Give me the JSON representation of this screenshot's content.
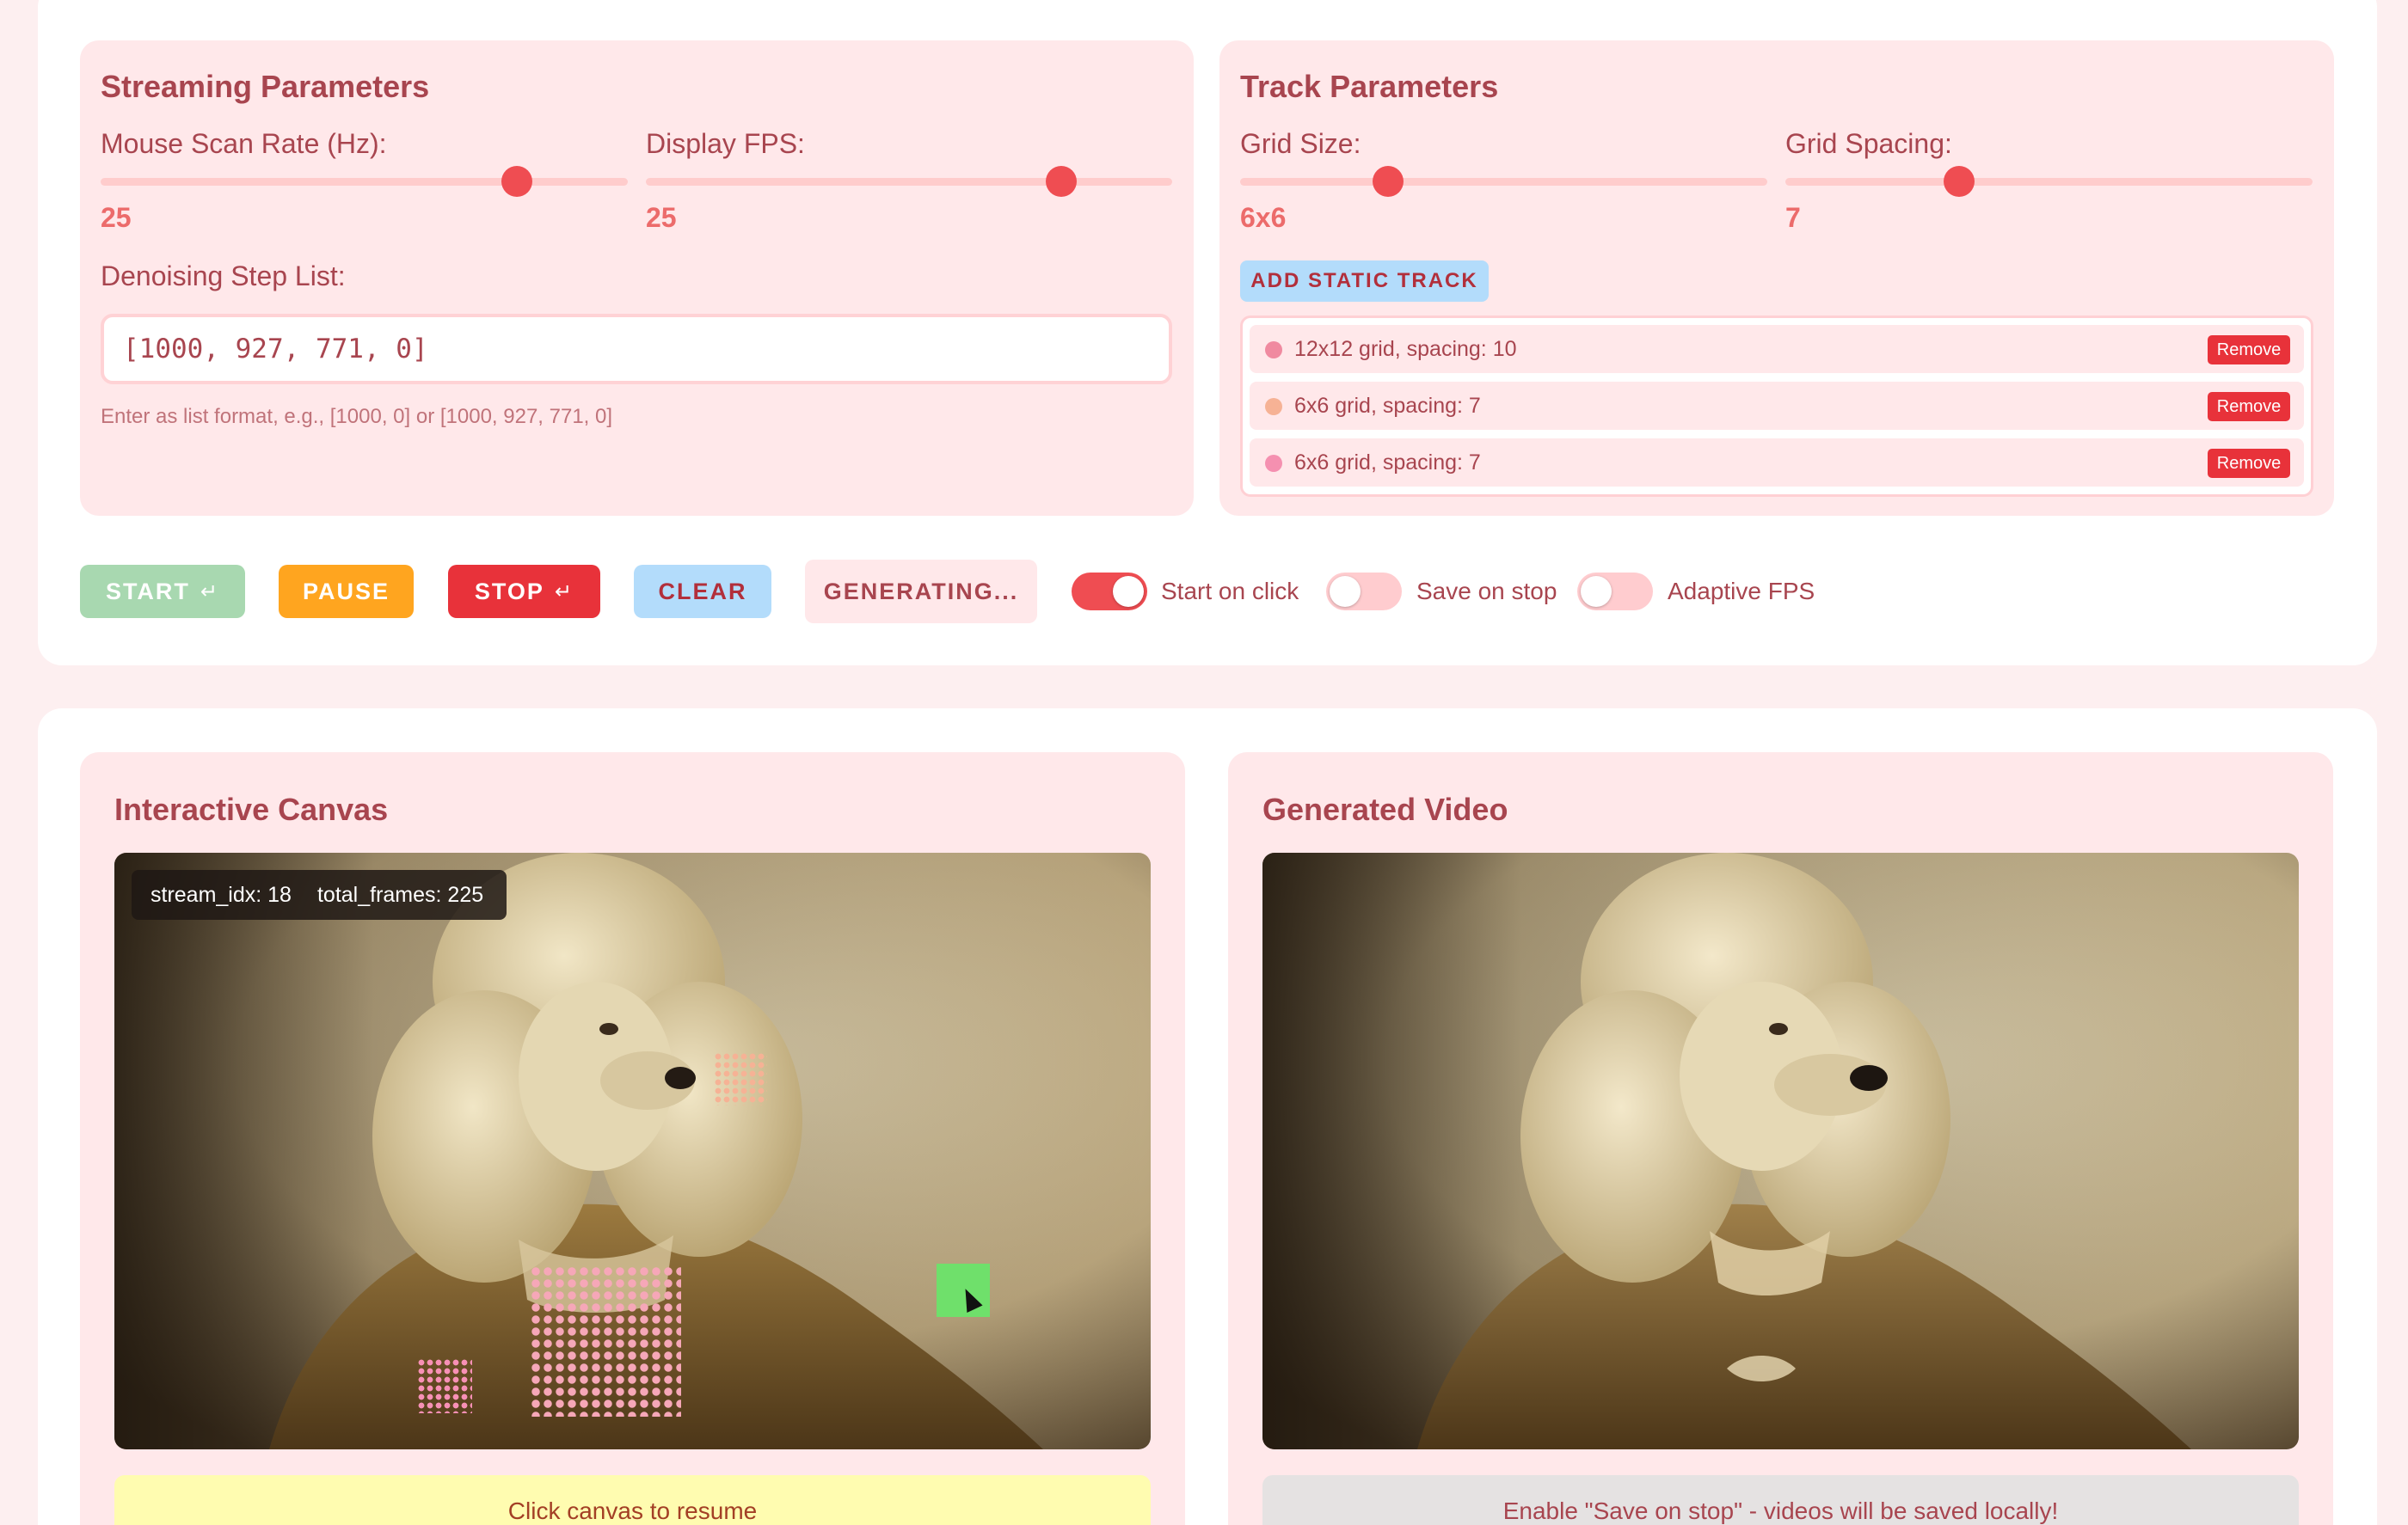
{
  "streaming": {
    "title": "Streaming Parameters",
    "scan_rate_label": "Mouse Scan Rate (Hz):",
    "scan_rate_value": "25",
    "scan_rate_fraction": 0.79,
    "fps_label": "Display FPS:",
    "fps_value": "25",
    "fps_fraction": 0.79,
    "denoise_label": "Denoising Step List:",
    "denoise_value": "[1000, 927, 771, 0]",
    "denoise_hint": "Enter as list format, e.g., [1000, 0] or [1000, 927, 771, 0]"
  },
  "track": {
    "title": "Track Parameters",
    "grid_size_label": "Grid Size:",
    "grid_size_value": "6x6",
    "grid_size_fraction": 0.28,
    "grid_spacing_label": "Grid Spacing:",
    "grid_spacing_value": "7",
    "grid_spacing_fraction": 0.33,
    "add_button": "ADD STATIC TRACK",
    "items": [
      {
        "text": "12x12 grid, spacing: 10",
        "remove": "Remove",
        "color": "#f08aa0"
      },
      {
        "text": "6x6 grid, spacing: 7",
        "remove": "Remove",
        "color": "#f6b295"
      },
      {
        "text": "6x6 grid, spacing: 7",
        "remove": "Remove",
        "color": "#f590b0"
      }
    ]
  },
  "controls": {
    "start": "START",
    "pause": "PAUSE",
    "stop": "STOP",
    "clear": "CLEAR",
    "generating": "GENERATING...",
    "start_on_click": "Start on click",
    "save_on_stop": "Save on stop",
    "adaptive_fps": "Adaptive FPS",
    "start_on_click_on": true,
    "save_on_stop_on": false,
    "adaptive_fps_on": false
  },
  "canvas": {
    "title": "Interactive Canvas",
    "stream_idx": "stream_idx: 18",
    "total_frames": "total_frames: 225",
    "status": "Click canvas to resume"
  },
  "video": {
    "title": "Generated Video",
    "status": "Enable \"Save on stop\" - videos will be saved locally!"
  },
  "colors": {
    "accent": "#ef4d52",
    "start_bg": "#a8d8b0",
    "pause_bg": "#ffa51f",
    "stop_bg": "#e8323a",
    "clear_bg": "#b3dcfb"
  }
}
